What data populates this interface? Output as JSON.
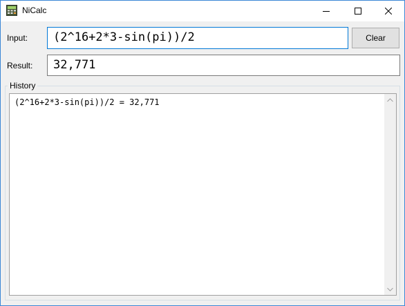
{
  "window": {
    "title": "NiCalc",
    "icon": "calculator-icon",
    "controls": [
      "minimize-icon",
      "maximize-icon",
      "close-icon"
    ]
  },
  "input": {
    "label": "Input:",
    "value": "(2^16+2*3-sin(pi))/2"
  },
  "clear_button": {
    "label": "Clear"
  },
  "result": {
    "label": "Result:",
    "value": "32,771"
  },
  "history": {
    "label": "History",
    "lines": [
      "(2^16+2*3-sin(pi))/2 = 32,771"
    ]
  },
  "colors": {
    "window_border": "#3a87d6",
    "focus_border": "#0078d7",
    "window_background": "#f0f0f0"
  }
}
